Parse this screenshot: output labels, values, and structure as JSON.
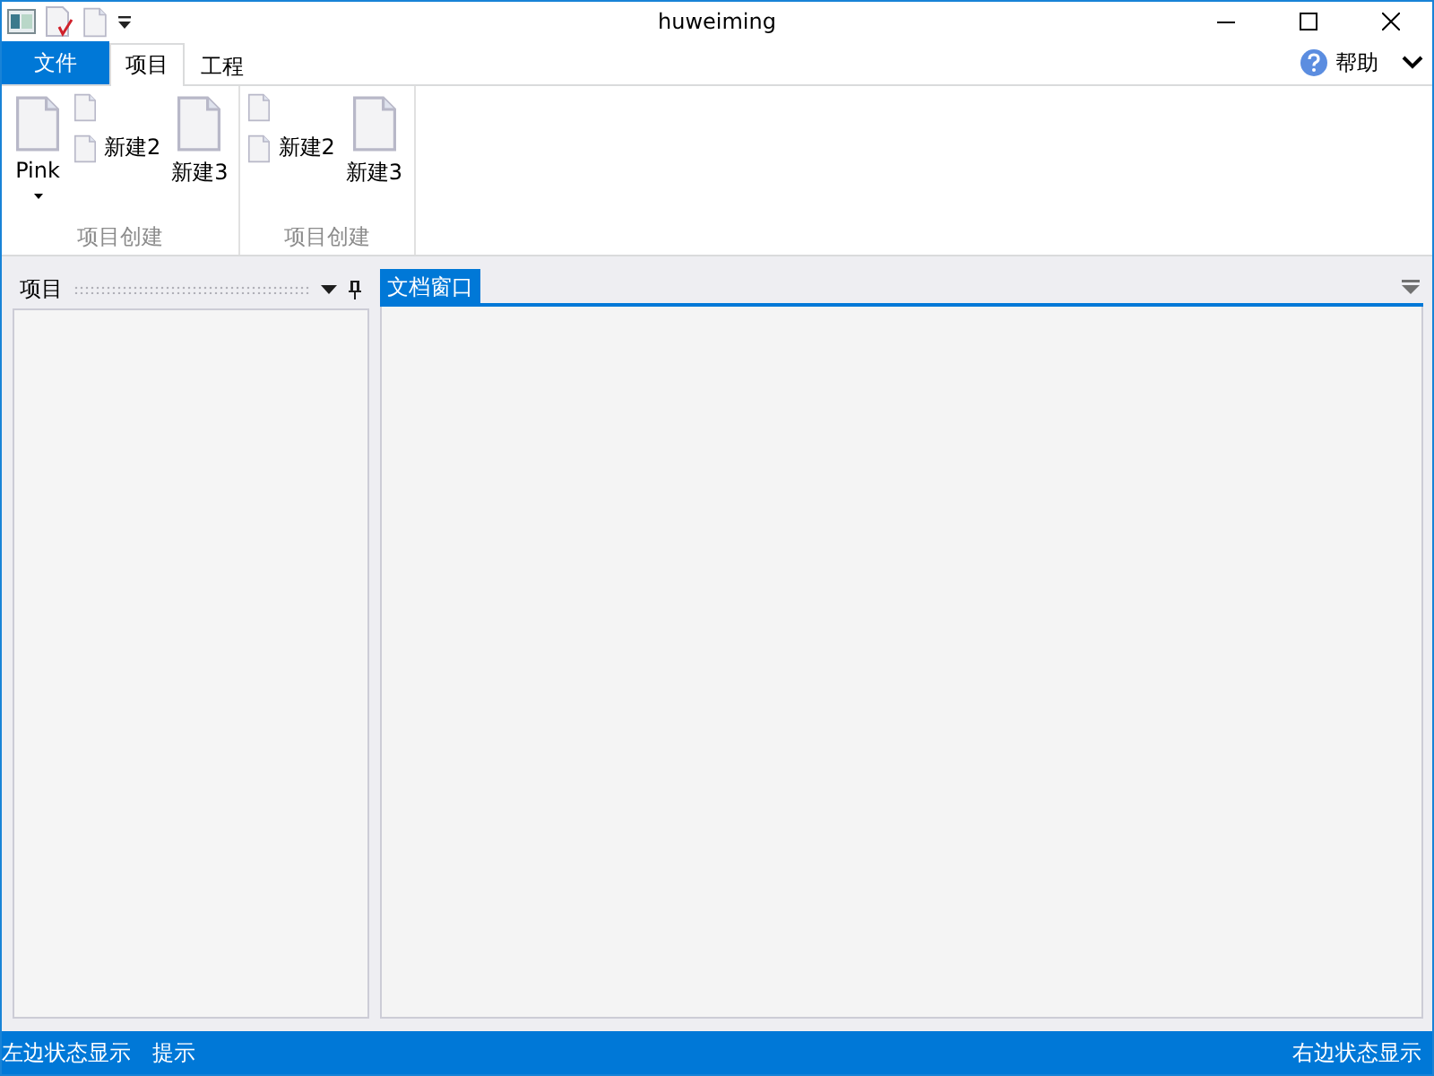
{
  "window": {
    "title": "huweiming"
  },
  "ribbon_tabs": [
    {
      "label": "文件",
      "kind": "file",
      "selected": false
    },
    {
      "label": "项目",
      "kind": "tab",
      "selected": true
    },
    {
      "label": "工程",
      "kind": "tab",
      "selected": false
    }
  ],
  "help": {
    "label": "帮助"
  },
  "ribbon_groups": [
    {
      "label": "项目创建",
      "items": [
        {
          "kind": "large",
          "label": "Pink",
          "dropdown": true
        },
        {
          "kind": "stack",
          "items": [
            {
              "kind": "icon"
            },
            {
              "kind": "small",
              "label": "新建2"
            }
          ]
        },
        {
          "kind": "large",
          "label": "新建3",
          "dropdown": false
        }
      ]
    },
    {
      "label": "项目创建",
      "items": [
        {
          "kind": "stack",
          "items": [
            {
              "kind": "icon"
            },
            {
              "kind": "small",
              "label": "新建2"
            }
          ]
        },
        {
          "kind": "large",
          "label": "新建3",
          "dropdown": false
        }
      ]
    }
  ],
  "dock_panel": {
    "title": "项目"
  },
  "document_tabs": [
    {
      "label": "文档窗口",
      "selected": true
    }
  ],
  "status_bar": {
    "left": [
      "左边状态显示",
      "提示"
    ],
    "right": "右边状态显示"
  }
}
